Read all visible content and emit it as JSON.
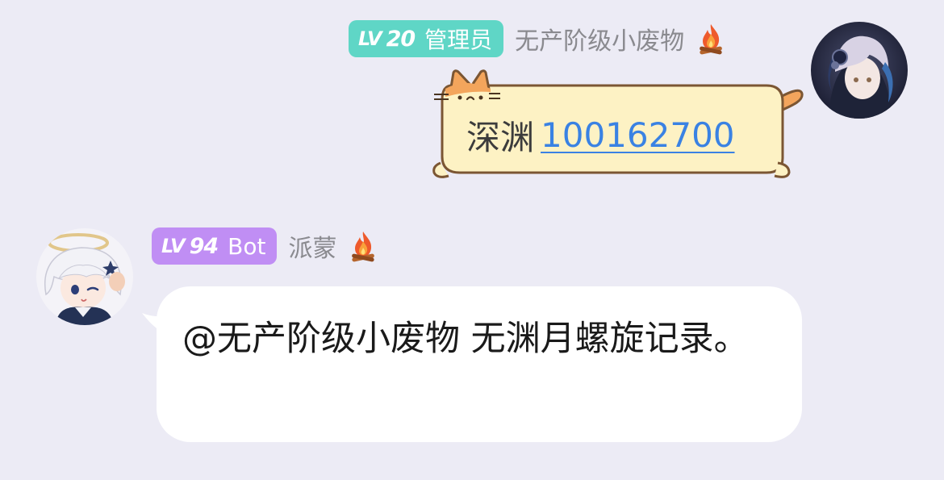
{
  "messages": [
    {
      "side": "right",
      "level_prefix": "LV",
      "level": "20",
      "role": "管理员",
      "sender": "无产阶级小废物",
      "badge_color": "#5fd6c6",
      "icon": "flame-icon",
      "text": "深渊",
      "link_text": "100162700",
      "bubble_style": "cat-bubble"
    },
    {
      "side": "left",
      "level_prefix": "LV",
      "level": "94",
      "role": "Bot",
      "sender": "派蒙",
      "badge_color": "#c08ef4",
      "icon": "flame-icon",
      "text": "@无产阶级小废物 无渊月螺旋记录。",
      "bubble_style": "white-bubble"
    }
  ],
  "colors": {
    "background": "#ecebf5",
    "link": "#3a82e3",
    "cat_bubble_fill": "#fdf2c4",
    "cat_bubble_outline": "#7b5633",
    "cat_orange": "#f3a55c"
  }
}
